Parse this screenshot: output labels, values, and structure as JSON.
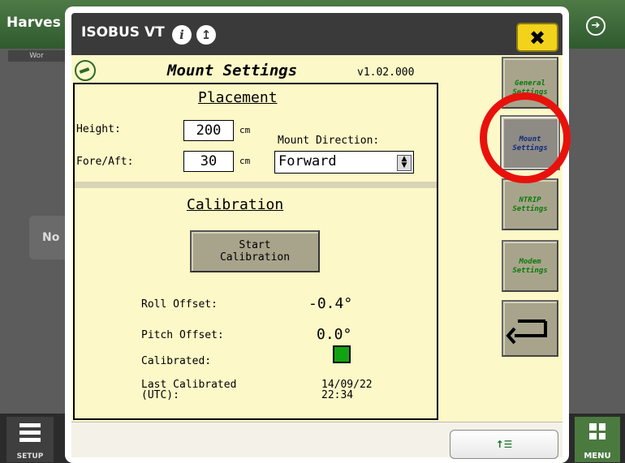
{
  "background": {
    "app_title": "Harves",
    "left_tab": "Wor",
    "left_panel_text": "No",
    "setup_label": "SETUP",
    "menu_label": "MENU"
  },
  "dialog": {
    "title": "ISOBUS VT",
    "close_label": "✖"
  },
  "screen": {
    "title": "Mount Settings",
    "version": "v1.02.000",
    "placement": {
      "heading": "Placement",
      "height_label": "Height:",
      "height_value": "200",
      "height_unit": "cm",
      "fore_aft_label": "Fore/Aft:",
      "fore_aft_value": "30",
      "fore_aft_unit": "cm",
      "mount_direction_label": "Mount Direction:",
      "mount_direction_value": "Forward"
    },
    "calibration": {
      "heading": "Calibration",
      "start_button": [
        "Start",
        "Calibration"
      ],
      "roll_label": "Roll Offset:",
      "roll_value": "-0.4°",
      "pitch_label": "Pitch Offset:",
      "pitch_value": "0.0°",
      "calibrated_label": "Calibrated:",
      "calibrated_color": "#12a312",
      "last_calibrated_label": [
        "Last Calibrated",
        "(UTC):"
      ],
      "last_calibrated_value": [
        "14/09/22",
        "22:34"
      ]
    },
    "side_nav": [
      {
        "label": [
          "General",
          "Settings"
        ]
      },
      {
        "label": [
          "Mount",
          "Settings"
        ],
        "active": true
      },
      {
        "label": [
          "NTRIP",
          "Settings"
        ]
      },
      {
        "label": [
          "Modem",
          "Settings"
        ]
      }
    ],
    "back_icon": "return-arrow-icon",
    "footer_button_icon": "softkey-list-icon"
  },
  "annotation_color": "#e8120c"
}
